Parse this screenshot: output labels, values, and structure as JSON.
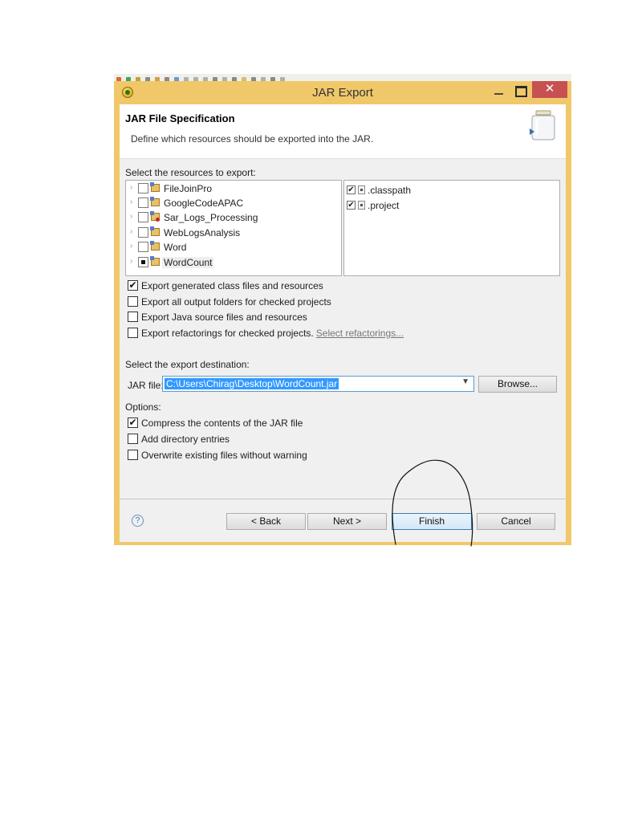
{
  "window": {
    "title": "JAR Export",
    "close_glyph": "✕"
  },
  "banner": {
    "title": "JAR File Specification",
    "description": "Define which resources should be exported into the JAR."
  },
  "resources": {
    "label": "Select the resources to export:",
    "projects": [
      {
        "label": "FileJoinPro",
        "checked": false,
        "error": false
      },
      {
        "label": "GoogleCodeAPAC",
        "checked": false,
        "error": false
      },
      {
        "label": "Sar_Logs_Processing",
        "checked": false,
        "error": true
      },
      {
        "label": "WebLogsAnalysis",
        "checked": false,
        "error": false
      },
      {
        "label": "Word",
        "checked": false,
        "error": false
      },
      {
        "label": "WordCount",
        "checked": "partial",
        "error": false
      }
    ],
    "files": [
      {
        "label": ".classpath",
        "checked": true
      },
      {
        "label": ".project",
        "checked": true
      }
    ]
  },
  "export_options": [
    {
      "label": "Export generated class files and resources",
      "checked": true
    },
    {
      "label": "Export all output folders for checked projects",
      "checked": false
    },
    {
      "label": "Export Java source files and resources",
      "checked": false
    },
    {
      "label": "Export refactorings for checked projects.",
      "checked": false,
      "link": "Select refactorings..."
    }
  ],
  "destination": {
    "label": "Select the export destination:",
    "jar_file_label": "JAR file:",
    "jar_file_value": "C:\\Users\\Chirag\\Desktop\\WordCount.jar",
    "browse_label": "Browse..."
  },
  "options": {
    "label": "Options:",
    "items": [
      {
        "label": "Compress the contents of the JAR file",
        "checked": true
      },
      {
        "label": "Add directory entries",
        "checked": false
      },
      {
        "label": "Overwrite existing files without warning",
        "checked": false
      }
    ]
  },
  "footer": {
    "help_glyph": "?",
    "back_label": "< Back",
    "next_label": "Next >",
    "finish_label": "Finish",
    "cancel_label": "Cancel"
  },
  "colors": {
    "window_frame": "#f0c86a",
    "close_button": "#c75050",
    "selection": "#3399ff",
    "annotation_stroke": "#111111"
  },
  "icons": {
    "app": "eclipse-icon",
    "banner": "jar-icon",
    "project": "java-project-icon",
    "file": "file-icon",
    "help": "help-icon"
  }
}
